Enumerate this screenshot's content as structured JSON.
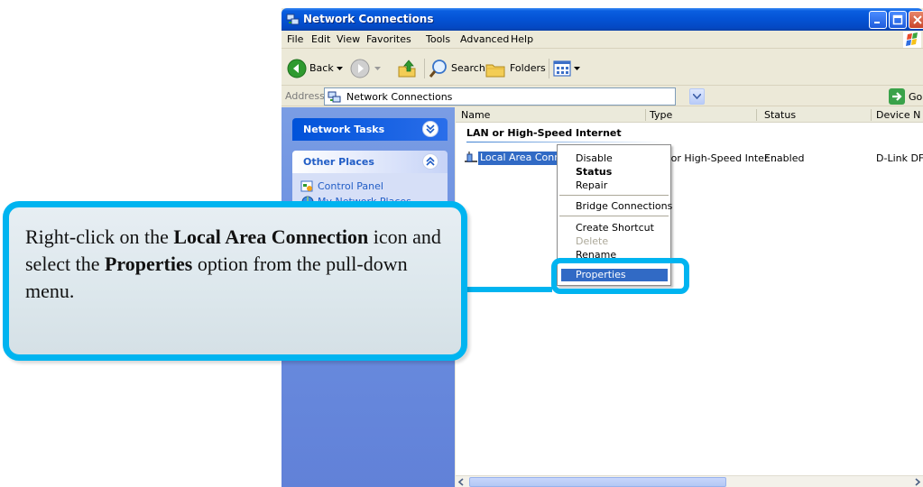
{
  "window": {
    "title": "Network Connections",
    "title_bar_color": "#0452d4"
  },
  "menubar": {
    "items": [
      "File",
      "Edit",
      "View",
      "Favorites",
      "Tools",
      "Advanced",
      "Help"
    ]
  },
  "toolbar": {
    "back_label": "Back",
    "search_label": "Search",
    "folders_label": "Folders"
  },
  "address": {
    "label": "Address",
    "value": "Network Connections",
    "go_label": "Go"
  },
  "taskpane": {
    "network_tasks_title": "Network Tasks",
    "other_places_title": "Other Places",
    "links": [
      "Control Panel",
      "My Network Places"
    ]
  },
  "content": {
    "columns": [
      "Name",
      "Type",
      "Status",
      "Device N"
    ],
    "group_title": "LAN or High-Speed Internet",
    "row": {
      "name": "Local Area Connection 3",
      "type": "LAN or High-Speed Inter...",
      "status": "Enabled",
      "device": "D-Link DF"
    }
  },
  "context_menu": {
    "disable": "Disable",
    "status": "Status",
    "repair": "Repair",
    "bridge": "Bridge Connections",
    "create_shortcut": "Create Shortcut",
    "delete": "Delete",
    "rename": "Rename",
    "properties": "Properties"
  },
  "callout": {
    "part1": "Right-click on the ",
    "bold1": "Local Area Connection",
    "part2": " icon and select the ",
    "bold2": "Properties",
    "part3": " option from the pull-down menu.",
    "border_color": "#00b4f0"
  }
}
